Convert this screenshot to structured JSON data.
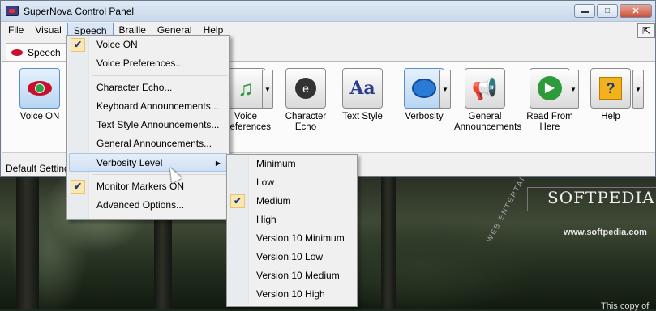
{
  "window": {
    "title": "SuperNova Control Panel"
  },
  "menubar": [
    "File",
    "Visual",
    "Speech",
    "Braille",
    "General",
    "Help"
  ],
  "tab": {
    "label": "Speech"
  },
  "toolbar": [
    {
      "label": "Voice ON",
      "icon": "voice-on-icon"
    },
    {
      "label": "Voice Preferences",
      "icon": "music-note-icon"
    },
    {
      "label": "Character Echo",
      "icon": "character-echo-icon"
    },
    {
      "label": "Text Style",
      "icon": "text-style-icon"
    },
    {
      "label": "Verbosity",
      "icon": "speech-bubble-icon"
    },
    {
      "label": "General Announcements",
      "icon": "megaphone-icon"
    },
    {
      "label": "Read From Here",
      "icon": "play-icon"
    },
    {
      "label": "Help",
      "icon": "question-icon"
    }
  ],
  "status": "Default Setting",
  "speech_menu": {
    "items": [
      {
        "label": "Voice ON",
        "checked": true
      },
      {
        "label": "Voice Preferences..."
      },
      {
        "label": "Character Echo..."
      },
      {
        "label": "Keyboard Announcements..."
      },
      {
        "label": "Text Style Announcements..."
      },
      {
        "label": "General Announcements..."
      },
      {
        "label": "Verbosity Level",
        "submenu": true
      },
      {
        "label": "Monitor Markers ON",
        "checked": true
      },
      {
        "label": "Advanced Options..."
      }
    ]
  },
  "verbosity_menu": {
    "items": [
      {
        "label": "Minimum"
      },
      {
        "label": "Low"
      },
      {
        "label": "Medium",
        "checked": true
      },
      {
        "label": "High"
      },
      {
        "label": "Version 10 Minimum"
      },
      {
        "label": "Version 10 Low"
      },
      {
        "label": "Version 10 Medium"
      },
      {
        "label": "Version 10 High"
      }
    ]
  },
  "background": {
    "softpedia": "SOFTPEDIA",
    "url": "www.softpedia.com",
    "web": "WEB ENTERTAINMENT",
    "copy_note": "This copy of"
  },
  "colors": {
    "accent": "#3b7fd0",
    "check_bg": "#fbe7b3",
    "highlight": "#cfe0f5"
  }
}
